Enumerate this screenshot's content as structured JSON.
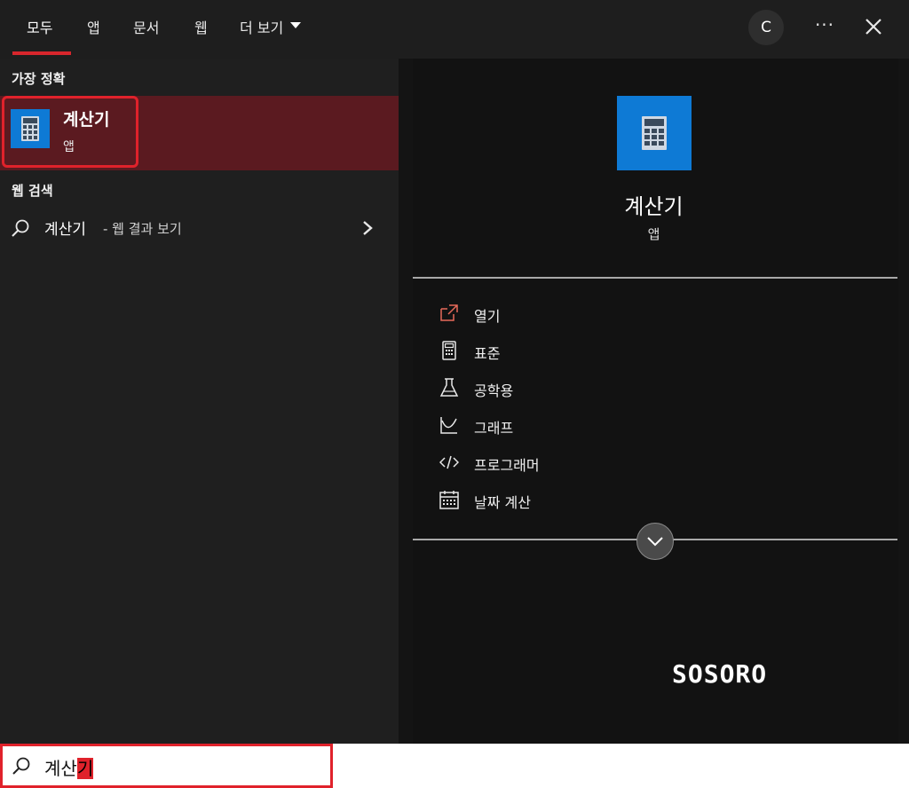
{
  "tabs": [
    {
      "label": "모두",
      "active": true
    },
    {
      "label": "앱"
    },
    {
      "label": "문서"
    },
    {
      "label": "웹"
    },
    {
      "label": "더 보기"
    }
  ],
  "header": {
    "avatar_letter": "C",
    "more_label": "···",
    "more_icon": "ellipsis-icon",
    "close_icon": "close-icon"
  },
  "best_match": {
    "section_label": "가장 정확",
    "title": "계산기",
    "subtitle": "앱",
    "icon": "calculator-icon"
  },
  "web_search": {
    "section_label": "웹 검색",
    "query": "계산기",
    "suffix": "- 웹 결과 보기",
    "icon": "search-icon",
    "arrow_icon": "chevron-right-icon"
  },
  "detail": {
    "app_name": "계산기",
    "app_kind": "앱",
    "tile_color": "#0e7ad5",
    "actions": [
      {
        "label": "열기",
        "icon": "open-icon"
      },
      {
        "label": "표준",
        "icon": "calculator-standard-icon"
      },
      {
        "label": "공학용",
        "icon": "flask-icon"
      },
      {
        "label": "그래프",
        "icon": "graph-icon"
      },
      {
        "label": "프로그래머",
        "icon": "code-icon"
      },
      {
        "label": "날짜 계산",
        "icon": "calendar-icon"
      }
    ],
    "expand_icon": "chevron-down-icon",
    "watermark": "SOSORO"
  },
  "search_box": {
    "typed_text": "계산",
    "composing_char": "기",
    "icon": "search-icon"
  },
  "colors": {
    "accent_red": "#e0222b",
    "selection_bg": "#5b1a20",
    "tab_underline": "#d8262c"
  }
}
